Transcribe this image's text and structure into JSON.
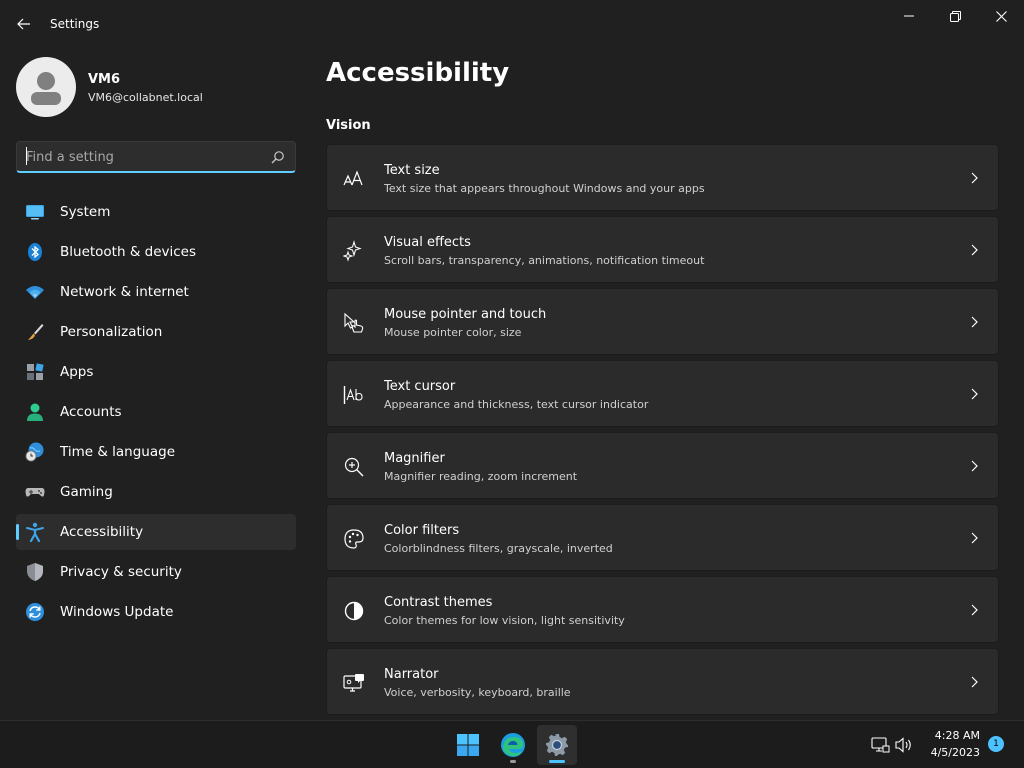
{
  "window": {
    "title": "Settings"
  },
  "profile": {
    "name": "VM6",
    "email": "VM6@collabnet.local"
  },
  "search": {
    "placeholder": "Find a setting",
    "value": ""
  },
  "nav": {
    "active": "Accessibility",
    "items": [
      {
        "label": "System",
        "icon": "system-icon"
      },
      {
        "label": "Bluetooth & devices",
        "icon": "bluetooth-icon"
      },
      {
        "label": "Network & internet",
        "icon": "wifi-icon"
      },
      {
        "label": "Personalization",
        "icon": "brush-icon"
      },
      {
        "label": "Apps",
        "icon": "apps-icon"
      },
      {
        "label": "Accounts",
        "icon": "person-icon"
      },
      {
        "label": "Time & language",
        "icon": "globe-clock-icon"
      },
      {
        "label": "Gaming",
        "icon": "gamepad-icon"
      },
      {
        "label": "Accessibility",
        "icon": "accessibility-icon"
      },
      {
        "label": "Privacy & security",
        "icon": "shield-icon"
      },
      {
        "label": "Windows Update",
        "icon": "update-icon"
      }
    ]
  },
  "page": {
    "title": "Accessibility",
    "section": "Vision",
    "cards": [
      {
        "title": "Text size",
        "description": "Text size that appears throughout Windows and your apps",
        "icon": "text-size-icon"
      },
      {
        "title": "Visual effects",
        "description": "Scroll bars, transparency, animations, notification timeout",
        "icon": "sparkle-icon"
      },
      {
        "title": "Mouse pointer and touch",
        "description": "Mouse pointer color, size",
        "icon": "pointer-hand-icon"
      },
      {
        "title": "Text cursor",
        "description": "Appearance and thickness, text cursor indicator",
        "icon": "text-cursor-icon"
      },
      {
        "title": "Magnifier",
        "description": "Magnifier reading, zoom increment",
        "icon": "magnifier-icon"
      },
      {
        "title": "Color filters",
        "description": "Colorblindness filters, grayscale, inverted",
        "icon": "palette-icon"
      },
      {
        "title": "Contrast themes",
        "description": "Color themes for low vision, light sensitivity",
        "icon": "contrast-icon"
      },
      {
        "title": "Narrator",
        "description": "Voice, verbosity, keyboard, braille",
        "icon": "narrator-icon"
      }
    ]
  },
  "taskbar": {
    "apps": [
      {
        "name": "Start",
        "icon": "windows-start-icon"
      },
      {
        "name": "Microsoft Edge",
        "icon": "edge-icon"
      },
      {
        "name": "Settings",
        "icon": "settings-gear-icon"
      }
    ],
    "time": "4:28 AM",
    "date": "4/5/2023",
    "notification_count": "1"
  },
  "colors": {
    "accent": "#60cdff",
    "background": "#202020",
    "card": "#2b2b2b"
  }
}
